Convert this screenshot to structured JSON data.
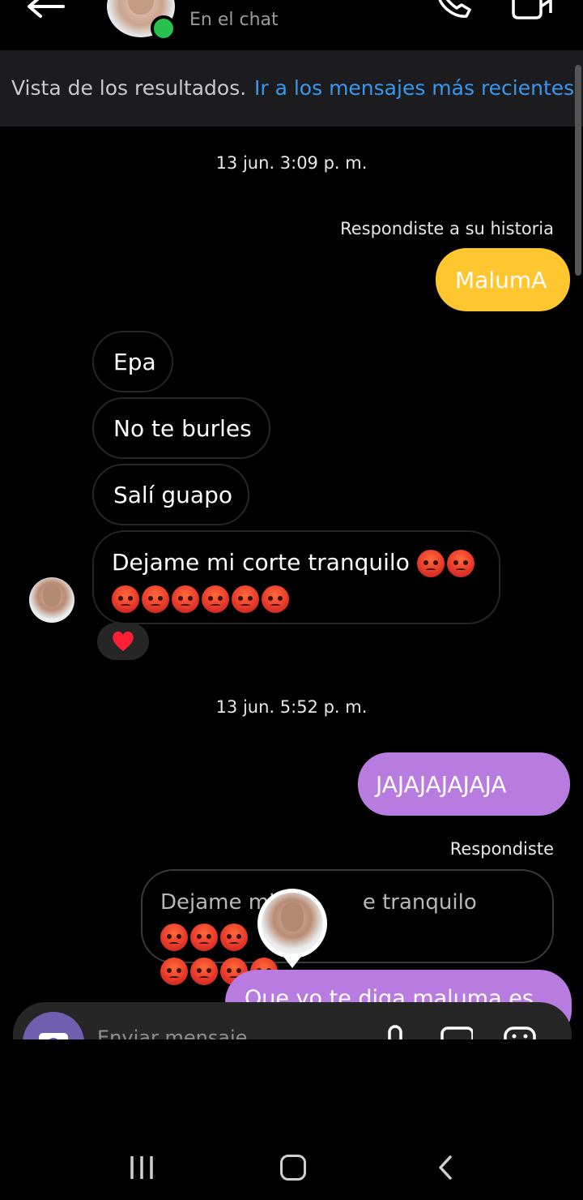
{
  "header": {
    "status": "En el chat",
    "icons": [
      "back-arrow-icon",
      "phone-icon",
      "video-camera-icon"
    ]
  },
  "banner": {
    "text": "Vista de los resultados.",
    "link": "Ir a los mensajes más recientes"
  },
  "messages": {
    "timestamp_1": "13 jun. 3:09 p. m.",
    "reply_label_1": "Respondiste a su historia",
    "out_1": "MalumA",
    "in_1": "Epa",
    "in_2": "No te burles",
    "in_3": "Salí guapo",
    "in_4": "Dejame mi corte tranquilo",
    "in_4_emoji_count": 8,
    "reaction": "❤️",
    "timestamp_2": "13 jun. 5:52 p. m.",
    "out_2": "JAJAJAJAJAJA",
    "reply_label_2": "Respondiste",
    "reply_preview_start": "Dejame mi",
    "reply_preview_end": "e tranquilo",
    "out_3_partial": "Que yo te diga maluma es"
  },
  "composer": {
    "placeholder": "Enviar mensaje..."
  },
  "colors": {
    "accent_link": "#3897f0",
    "bubble_yellow": "#ffc630",
    "bubble_purple": "#b87be0",
    "online": "#27c24c"
  }
}
